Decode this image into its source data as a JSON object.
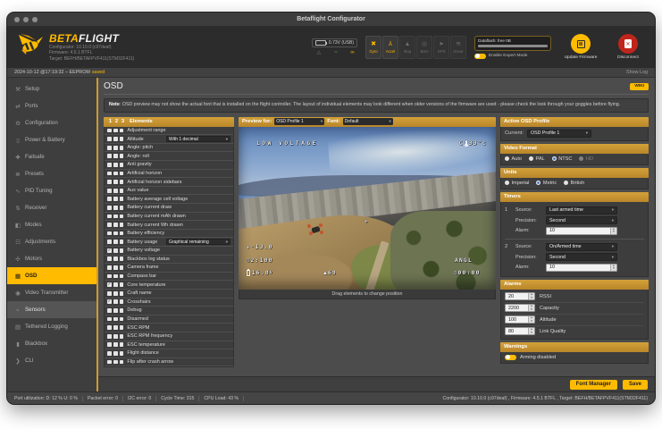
{
  "window": {
    "title": "Betaflight Configurator"
  },
  "header": {
    "brand_beta": "BETA",
    "brand_flight": "FLIGHT",
    "info_lines": [
      "Configurator: 10.10.0 (c97deaf)",
      "Firmware: 4.5.1 BTFL",
      "Target: BEFH/BETAFPVF411(STM32F411)"
    ],
    "voltage": "0.73V (USB)",
    "sensors": [
      {
        "label": "Gyro",
        "active": true
      },
      {
        "label": "Accel",
        "active": true
      },
      {
        "label": "Mag",
        "active": false
      },
      {
        "label": "Baro",
        "active": false
      },
      {
        "label": "GPS",
        "active": false
      },
      {
        "label": "Sonar",
        "active": false
      }
    ],
    "dataflash_label": "Dataflash: free 0B",
    "expert_mode_label": "Enable Expert Mode",
    "update_firmware_label": "Update Firmware",
    "disconnect_label": "Disconnect"
  },
  "log_bar": {
    "text": "2024-10-12 @17:19:32 – EEPROM",
    "saved": "saved",
    "show_log": "Show Log"
  },
  "sidebar": {
    "items": [
      {
        "label": "Setup",
        "icon": "wrench"
      },
      {
        "label": "Ports",
        "icon": "plug"
      },
      {
        "label": "Configuration",
        "icon": "gear"
      },
      {
        "label": "Power & Battery",
        "icon": "battery"
      },
      {
        "label": "Failsafe",
        "icon": "failsafe"
      },
      {
        "label": "Presets",
        "icon": "presets"
      },
      {
        "label": "PID Tuning",
        "icon": "pid"
      },
      {
        "label": "Receiver",
        "icon": "receiver"
      },
      {
        "label": "Modes",
        "icon": "modes"
      },
      {
        "label": "Adjustments",
        "icon": "adjustments"
      },
      {
        "label": "Motors",
        "icon": "motors"
      },
      {
        "label": "OSD",
        "icon": "osd",
        "active": true
      },
      {
        "label": "Video Transmitter",
        "icon": "vtx"
      },
      {
        "label": "Sensors",
        "icon": "sensors",
        "hover": true
      },
      {
        "label": "Tethered Logging",
        "icon": "logging"
      },
      {
        "label": "Blackbox",
        "icon": "blackbox"
      },
      {
        "label": "CLI",
        "icon": "cli"
      }
    ]
  },
  "osd": {
    "page_title": "OSD",
    "wiki_label": "WIKI",
    "note_bold": "Note",
    "note_text": ": OSD preview may not show the actual font that is installed on the flight controller. The layout of individual elements may look different when older versions of the firmware are used - please check the look through your goggles before flying.",
    "elements_panel": {
      "header_nums": [
        "1",
        "2",
        "3"
      ],
      "header_label": "Elements",
      "rows": [
        {
          "label": "Adjustment range",
          "checks": [
            0,
            0,
            0
          ]
        },
        {
          "label": "Altitude",
          "checks": [
            0,
            0,
            0
          ],
          "select": "With 1 decimal"
        },
        {
          "label": "Angle: pitch",
          "checks": [
            0,
            0,
            0
          ]
        },
        {
          "label": "Angle: roll",
          "checks": [
            0,
            0,
            0
          ]
        },
        {
          "label": "Anti gravity",
          "checks": [
            0,
            0,
            0
          ]
        },
        {
          "label": "Artificial horizon",
          "checks": [
            0,
            0,
            0
          ]
        },
        {
          "label": "Artificial horizon sidebars",
          "checks": [
            0,
            0,
            0
          ]
        },
        {
          "label": "Aux value",
          "checks": [
            0,
            0,
            0
          ]
        },
        {
          "label": "Battery average cell voltage",
          "checks": [
            0,
            0,
            0
          ]
        },
        {
          "label": "Battery current draw",
          "checks": [
            0,
            0,
            0
          ]
        },
        {
          "label": "Battery current mAh drawn",
          "checks": [
            0,
            0,
            0
          ]
        },
        {
          "label": "Battery current Wh drawn",
          "checks": [
            0,
            0,
            0
          ]
        },
        {
          "label": "Battery efficiency",
          "checks": [
            0,
            0,
            0
          ]
        },
        {
          "label": "Battery usage",
          "checks": [
            0,
            0,
            0
          ],
          "select": "Graphical remaining"
        },
        {
          "label": "Battery voltage",
          "checks": [
            1,
            0,
            0
          ]
        },
        {
          "label": "Blackbox log status",
          "checks": [
            0,
            0,
            0
          ]
        },
        {
          "label": "Camera frame",
          "checks": [
            0,
            0,
            0
          ]
        },
        {
          "label": "Compass bar",
          "checks": [
            0,
            0,
            0
          ]
        },
        {
          "label": "Core temperature",
          "checks": [
            1,
            0,
            0
          ]
        },
        {
          "label": "Craft name",
          "checks": [
            0,
            0,
            0
          ]
        },
        {
          "label": "Crosshairs",
          "checks": [
            1,
            0,
            0
          ]
        },
        {
          "label": "Debug",
          "checks": [
            0,
            0,
            0
          ]
        },
        {
          "label": "Disarmed",
          "checks": [
            0,
            0,
            0
          ]
        },
        {
          "label": "ESC RPM",
          "checks": [
            0,
            0,
            0
          ]
        },
        {
          "label": "ESC RPM frequency",
          "checks": [
            0,
            0,
            0
          ]
        },
        {
          "label": "ESC temperature",
          "checks": [
            0,
            0,
            0
          ]
        },
        {
          "label": "Flight distance",
          "checks": [
            0,
            0,
            0
          ]
        },
        {
          "label": "Flip after crash arrow",
          "checks": [
            0,
            0,
            0
          ]
        }
      ]
    },
    "preview_panel": {
      "preview_for_label": "Preview for:",
      "profile_value": "OSD Profile 1",
      "font_label": "Font:",
      "font_value": "Default",
      "drag_hint": "Drag elements to change position",
      "overlay": {
        "warning": "LOW VOLTAGE",
        "core_temp_prefix": "C",
        "core_temp_value": "33°c",
        "crosshair": "+",
        "altitude": "-13.0",
        "timer2": "2:100",
        "battery_voltage": "16.8",
        "battery_unit": "v",
        "rssi": "69",
        "flymode": "ANGL",
        "timer1": "00:00"
      }
    },
    "right_panel": {
      "profile_section": {
        "title": "Active OSD Profile",
        "current_label": "Current:",
        "value": "OSD Profile 1"
      },
      "video_format": {
        "title": "Video Format",
        "options": [
          {
            "label": "Auto"
          },
          {
            "label": "PAL"
          },
          {
            "label": "NTSC",
            "selected": true
          },
          {
            "label": "HD",
            "disabled": true
          }
        ]
      },
      "units": {
        "title": "Units",
        "options": [
          {
            "label": "Imperial"
          },
          {
            "label": "Metric",
            "selected": true
          },
          {
            "label": "British"
          }
        ]
      },
      "timers": {
        "title": "Timers",
        "source_label": "Source:",
        "precision_label": "Precision:",
        "alarm_label": "Alarm:",
        "items": [
          {
            "num": "1",
            "source": "Last armed time",
            "precision": "Second",
            "alarm": "10"
          },
          {
            "num": "2",
            "source": "On/Armed time",
            "precision": "Second",
            "alarm": "10"
          }
        ]
      },
      "alarms": {
        "title": "Alarms",
        "items": [
          {
            "value": "20",
            "label": "RSSI"
          },
          {
            "value": "2200",
            "label": "Capacity"
          },
          {
            "value": "100",
            "label": "Altitude"
          },
          {
            "value": "80",
            "label": "Link Quality"
          }
        ]
      },
      "warnings": {
        "title": "Warnings",
        "toggle_label": "Arming disabled",
        "toggle_on": true
      }
    },
    "actions": {
      "font_manager": "Font Manager",
      "save": "Save"
    }
  },
  "footer": {
    "segments": [
      "Port utilization: D: 12 % U: 0 %",
      "Packet error: 0",
      "I2C error: 0",
      "Cycle Time: 315",
      "CPU Load: 43 %"
    ],
    "right": "Configurator: 10.10.0 (c97deaf) , Firmware: 4.5.1 BTFL , Target: BEFH/BETAFPVF411(STM32F411)"
  },
  "colors": {
    "accent": "#ffbb00",
    "header_gold": "#c28e2c",
    "danger": "#c0251c"
  }
}
